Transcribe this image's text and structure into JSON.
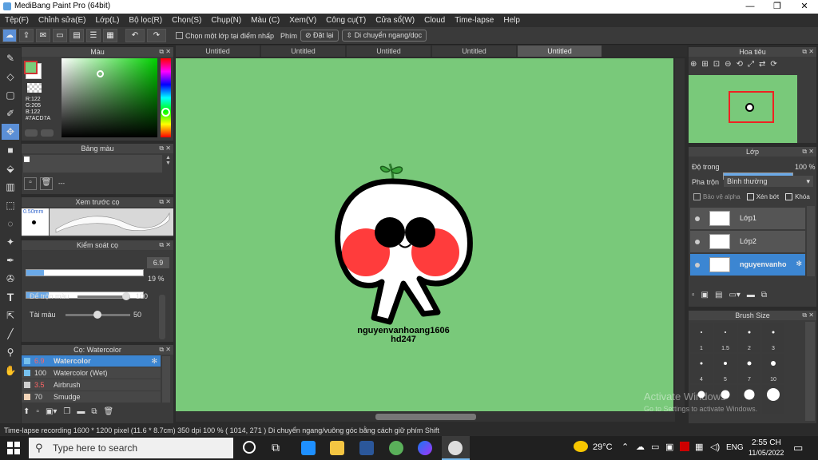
{
  "window": {
    "title": "MediBang Paint Pro (64bit)",
    "min": "—",
    "max": "❐",
    "close": "✕"
  },
  "menu": [
    "Tệp(F)",
    "Chỉnh sửa(E)",
    "Lớp(L)",
    "Bộ lọc(R)",
    "Chọn(S)",
    "Chụp(N)",
    "Màu (C)",
    "Xem(V)",
    "Công cụ(T)",
    "Cửa sổ(W)",
    "Cloud",
    "Time-lapse",
    "Help"
  ],
  "toolbar": {
    "select_layer_label": "Chọn một lớp tại điểm nhấp",
    "key_label": "Phím",
    "reset_label": "Đặt lại",
    "move_label": "Di chuyển ngang/dọc"
  },
  "color_panel": {
    "title": "Màu",
    "r": "R:122",
    "g": "G:205",
    "b": "B:122",
    "hex": "#7ACD7A",
    "foreground": "#7acd7a"
  },
  "palette_panel": {
    "title": "Bảng màu",
    "value": "---"
  },
  "brush_preview": {
    "title": "Xem trước cọ",
    "size": "0.50mm"
  },
  "brush_control": {
    "title": "Kiểm soát cọ",
    "size": "6.9",
    "size_fill": 0.15,
    "opacity": "19 %",
    "opacity_fill": 0.19,
    "blend_label": "Để trộn màu",
    "blend_value": "100",
    "fade_label": "Tài màu",
    "fade_value": "50"
  },
  "brush_list": {
    "title": "Cọ: Watercolor",
    "items": [
      {
        "size": "6.9",
        "name": "Watercolor",
        "color": "#76c0ee"
      },
      {
        "size": "100",
        "name": "Watercolor (Wet)",
        "color": "#76c0ee"
      },
      {
        "size": "3.5",
        "name": "Airbrush",
        "color": "#d0d0d0"
      },
      {
        "size": "70",
        "name": "Smudge",
        "color": "#f2d4b8"
      }
    ]
  },
  "tabs": [
    "Untitled",
    "Untitled",
    "Untitled",
    "Untitled",
    "Untitled"
  ],
  "canvas": {
    "signature_line1": "nguyenvanhoang1606",
    "signature_line2": "hd247"
  },
  "navigator": {
    "title": "Hoa tiêu"
  },
  "layers": {
    "title": "Lớp",
    "opacity_label": "Độ trong",
    "opacity_value": "100 %",
    "opacity_fill": 1.0,
    "blend_label": "Pha trộn",
    "blend_value": "Bình thường",
    "protect_alpha": "Bảo vệ alpha",
    "clipping": "Xén bớt",
    "lock": "Khóa",
    "items": [
      "Lớp1",
      "Lớp2",
      "nguyenvanho"
    ]
  },
  "brush_size": {
    "title": "Brush Size",
    "row1": [
      "1",
      "1.5",
      "2",
      "3"
    ],
    "row2": [
      "4",
      "5",
      "7",
      "10"
    ]
  },
  "watermark": {
    "line1": "Activate Windows",
    "line2": "Go to Settings to activate Windows."
  },
  "status": "Time-lapse recording   1600 * 1200 pixel  (11.6 * 8.7cm)  350 dpi  100 %  ( 1014, 271 )  Di chuyển ngang/vuông góc bằng cách giữ phím Shift",
  "taskbar": {
    "search_placeholder": "Type here to search",
    "temp": "29°C",
    "lang": "ENG",
    "time": "2:55 CH",
    "date": "11/05/2022"
  }
}
